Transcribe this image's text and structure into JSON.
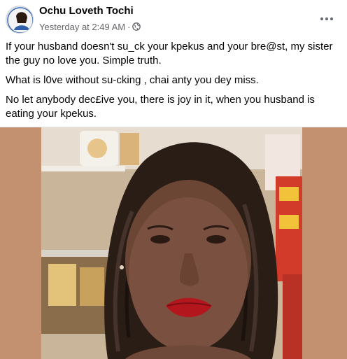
{
  "post": {
    "author": "Ochu Loveth Tochi",
    "timestamp": "Yesterday at 2:49 AM",
    "separator": "·",
    "privacy_icon": "globe-icon",
    "more_icon": "more-horizontal-icon",
    "paragraphs": [
      "If your husband doesn't su_ck your kpekus and your bre@st, my sister the guy no love you. Simple truth.",
      "What is l0ve without su-cking , chai anty you dey miss.",
      "No let anybody dec£ive you, there is joy in it, when you husband is eating your kpekus."
    ]
  },
  "colors": {
    "photo_background": "#c39170",
    "secondary_text": "#65676b"
  }
}
